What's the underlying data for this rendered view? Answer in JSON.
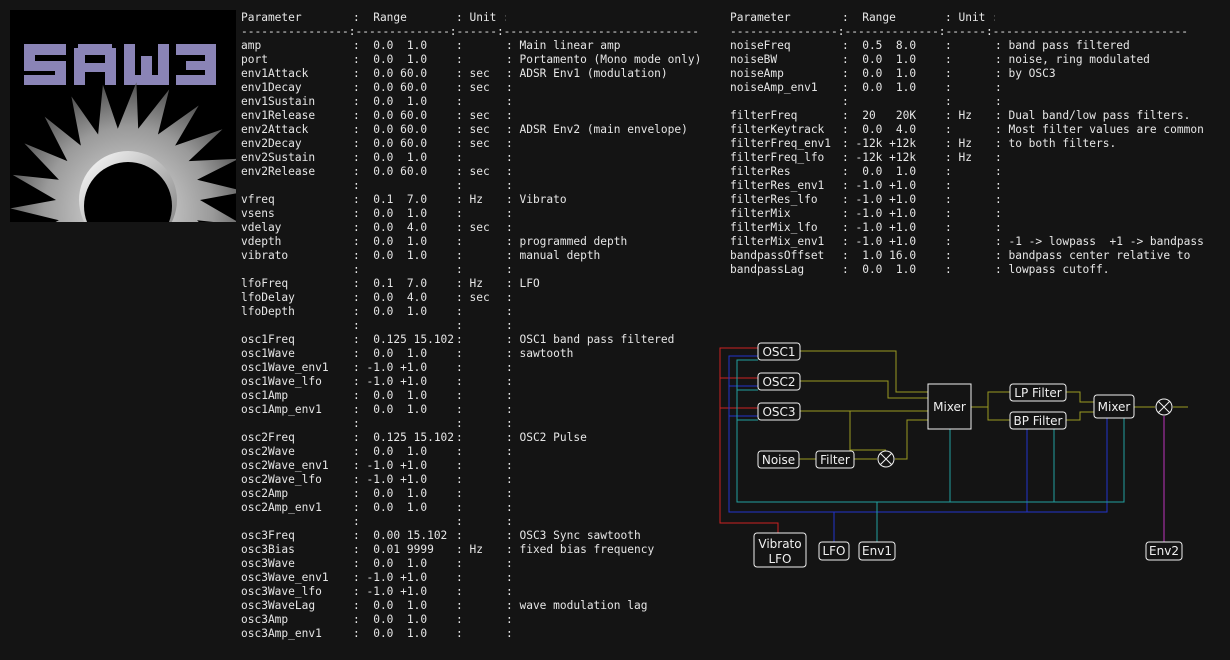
{
  "logo": {
    "text": "SAW3"
  },
  "left_table": {
    "header": [
      "Parameter",
      ":  Range",
      ": Unit :",
      ""
    ],
    "separator": "----------------:--------------:------:-----------------------------",
    "rows": [
      [
        "amp",
        ":  0.0  1.0",
        ":",
        ": Main linear amp"
      ],
      [
        "port",
        ":  0.0  1.0",
        ":",
        ": Portamento (Mono mode only)"
      ],
      [
        "env1Attack",
        ":  0.0 60.0",
        ": sec",
        ": ADSR Env1 (modulation)"
      ],
      [
        "env1Decay",
        ":  0.0 60.0",
        ": sec",
        ":"
      ],
      [
        "env1Sustain",
        ":  0.0  1.0",
        ":",
        ":"
      ],
      [
        "env1Release",
        ":  0.0 60.0",
        ": sec",
        ":"
      ],
      [
        "env2Attack",
        ":  0.0 60.0",
        ": sec",
        ": ADSR Env2 (main envelope)"
      ],
      [
        "env2Decay",
        ":  0.0 60.0",
        ": sec",
        ":"
      ],
      [
        "env2Sustain",
        ":  0.0  1.0",
        ":",
        ":"
      ],
      [
        "env2Release",
        ":  0.0 60.0",
        ": sec",
        ":"
      ],
      [
        "",
        ":",
        ":",
        ":"
      ],
      [
        "vfreq",
        ":  0.1  7.0",
        ": Hz",
        ": Vibrato"
      ],
      [
        "vsens",
        ":  0.0  1.0",
        ":",
        ":"
      ],
      [
        "vdelay",
        ":  0.0  4.0",
        ": sec",
        ":"
      ],
      [
        "vdepth",
        ":  0.0  1.0",
        ":",
        ": programmed depth"
      ],
      [
        "vibrato",
        ":  0.0  1.0",
        ":",
        ": manual depth"
      ],
      [
        "",
        ":",
        ":",
        ":"
      ],
      [
        "lfoFreq",
        ":  0.1  7.0",
        ": Hz",
        ": LFO"
      ],
      [
        "lfoDelay",
        ":  0.0  4.0",
        ": sec",
        ":"
      ],
      [
        "lfoDepth",
        ":  0.0  1.0",
        ":",
        ":"
      ],
      [
        "",
        ":",
        ":",
        ":"
      ],
      [
        "osc1Freq",
        ":  0.125 15.102",
        ":",
        ": OSC1 band pass filtered"
      ],
      [
        "osc1Wave",
        ":  0.0  1.0",
        ":",
        ": sawtooth"
      ],
      [
        "osc1Wave_env1",
        ": -1.0 +1.0",
        ":",
        ":"
      ],
      [
        "osc1Wave_lfo",
        ": -1.0 +1.0",
        ":",
        ":"
      ],
      [
        "osc1Amp",
        ":  0.0  1.0",
        ":",
        ":"
      ],
      [
        "osc1Amp_env1",
        ":  0.0  1.0",
        ":",
        ":"
      ],
      [
        "",
        ":",
        ":",
        ":"
      ],
      [
        "osc2Freq",
        ":  0.125 15.102",
        ":",
        ": OSC2 Pulse"
      ],
      [
        "osc2Wave",
        ":  0.0  1.0",
        ":",
        ":"
      ],
      [
        "osc2Wave_env1",
        ": -1.0 +1.0",
        ":",
        ":"
      ],
      [
        "osc2Wave_lfo",
        ": -1.0 +1.0",
        ":",
        ":"
      ],
      [
        "osc2Amp",
        ":  0.0  1.0",
        ":",
        ":"
      ],
      [
        "osc2Amp_env1",
        ":  0.0  1.0",
        ":",
        ":"
      ],
      [
        "",
        ":",
        ":",
        ":"
      ],
      [
        "osc3Freq",
        ":  0.00 15.102",
        ":",
        ": OSC3 Sync sawtooth"
      ],
      [
        "osc3Bias",
        ":  0.01 9999",
        ": Hz",
        ": fixed bias frequency"
      ],
      [
        "osc3Wave",
        ":  0.0  1.0",
        ":",
        ":"
      ],
      [
        "osc3Wave_env1",
        ": -1.0 +1.0",
        ":",
        ":"
      ],
      [
        "osc3Wave_lfo",
        ": -1.0 +1.0",
        ":",
        ":"
      ],
      [
        "osc3WaveLag",
        ":  0.0  1.0",
        ":",
        ": wave modulation lag"
      ],
      [
        "osc3Amp",
        ":  0.0  1.0",
        ":",
        ":"
      ],
      [
        "osc3Amp_env1",
        ":  0.0  1.0",
        ":",
        ":"
      ]
    ]
  },
  "right_table": {
    "header": [
      "Parameter",
      ":  Range",
      ": Unit :",
      ""
    ],
    "separator": "----------------:--------------:------:-----------------------------",
    "rows": [
      [
        "noiseFreq",
        ":  0.5  8.0",
        ":",
        ": band pass filtered"
      ],
      [
        "noiseBW",
        ":  0.0  1.0",
        ":",
        ": noise, ring modulated"
      ],
      [
        "noiseAmp",
        ":  0.0  1.0",
        ":",
        ": by OSC3"
      ],
      [
        "noiseAmp_env1",
        ":  0.0  1.0",
        ":",
        ":"
      ],
      [
        "",
        ":",
        ":",
        ":"
      ],
      [
        "filterFreq",
        ":  20   20K",
        ": Hz",
        ": Dual band/low pass filters."
      ],
      [
        "filterKeytrack",
        ":  0.0  4.0",
        ":",
        ": Most filter values are common"
      ],
      [
        "filterFreq_env1",
        ": -12k +12k",
        ": Hz",
        ": to both filters."
      ],
      [
        "filterFreq_lfo",
        ": -12k +12k",
        ": Hz",
        ":"
      ],
      [
        "filterRes",
        ":  0.0  1.0",
        ":",
        ":"
      ],
      [
        "filterRes_env1",
        ": -1.0 +1.0",
        ":",
        ":"
      ],
      [
        "filterRes_lfo",
        ": -1.0 +1.0",
        ":",
        ":"
      ],
      [
        "filterMix",
        ": -1.0 +1.0",
        ":",
        ":"
      ],
      [
        "filterMix_lfo",
        ": -1.0 +1.0",
        ":",
        ":"
      ],
      [
        "filterMix_env1",
        ": -1.0 +1.0",
        ":",
        ": -1 -> lowpass  +1 -> bandpass"
      ],
      [
        "bandpassOffset",
        ":  1.0 16.0",
        ":",
        ": bandpass center relative to"
      ],
      [
        "bandpassLag",
        ":  0.0  1.0",
        ":",
        ": lowpass cutoff."
      ]
    ]
  },
  "diagram": {
    "osc1": "OSC1",
    "osc2": "OSC2",
    "osc3": "OSC3",
    "noise": "Noise",
    "filter": "Filter",
    "mixer1": "Mixer",
    "lp_filter": "LP Filter",
    "bp_filter": "BP Filter",
    "mixer2": "Mixer",
    "vibrato_lfo_l1": "Vibrato",
    "vibrato_lfo_l2": "LFO",
    "lfo": "LFO",
    "env1": "Env1",
    "env2": "Env2",
    "colors": {
      "audio": "#9a9a22",
      "vibrato": "#cc2222",
      "lfo": "#2233cc",
      "env1": "#22a0a0",
      "env2": "#bb33bb"
    }
  }
}
